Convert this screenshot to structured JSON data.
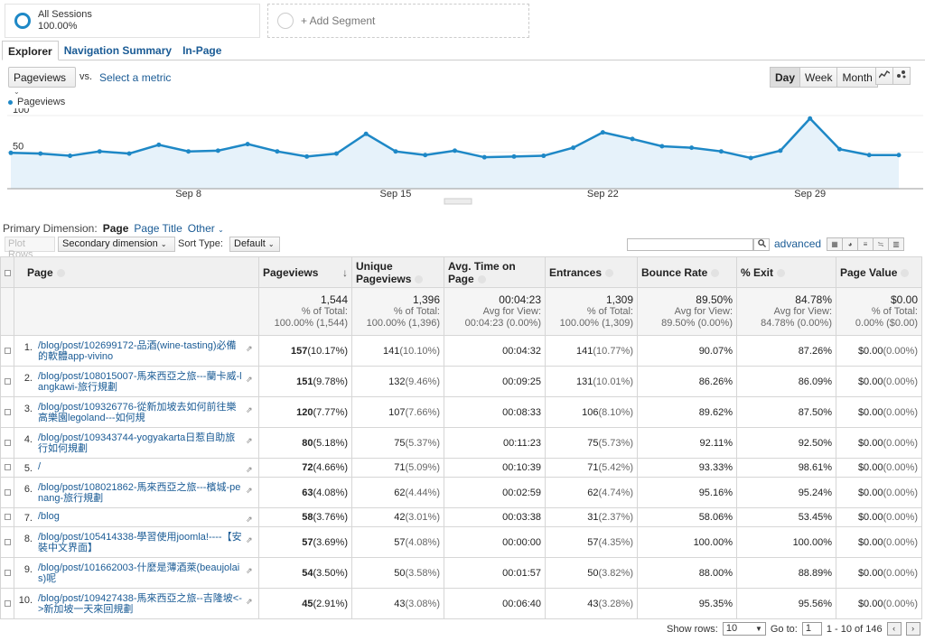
{
  "segments": {
    "all_sessions": {
      "name": "All Sessions",
      "pct": "100.00%"
    },
    "add_label": "+ Add Segment"
  },
  "tabs": [
    "Explorer",
    "Navigation Summary",
    "In-Page"
  ],
  "metric": {
    "selected": "Pageviews",
    "vs": "vs.",
    "select_metric": "Select a metric"
  },
  "period_buttons": [
    "Day",
    "Week",
    "Month"
  ],
  "chart_icons": [
    "line-chart-icon",
    "motion-chart-icon"
  ],
  "chart_data": {
    "type": "area",
    "series": [
      {
        "name": "Pageviews",
        "values": [
          49,
          48,
          45,
          51,
          48,
          60,
          51,
          52,
          61,
          51,
          44,
          48,
          75,
          51,
          46,
          52,
          43,
          44,
          45,
          56,
          77,
          68,
          58,
          56,
          51,
          42,
          52,
          96,
          54,
          46,
          46
        ]
      }
    ],
    "x_ticks": [
      {
        "index": 6,
        "label": "Sep 8"
      },
      {
        "index": 13,
        "label": "Sep 15"
      },
      {
        "index": 20,
        "label": "Sep 22"
      },
      {
        "index": 27,
        "label": "Sep 29"
      }
    ],
    "y_ticks": [
      {
        "value": 50,
        "label": "50"
      },
      {
        "value": 100,
        "label": "100"
      }
    ],
    "ylim": [
      0,
      100
    ],
    "color": "#1e88c6",
    "fill": "#e6f2fa"
  },
  "primary_dimension": {
    "label": "Primary Dimension:",
    "options": [
      "Page",
      "Page Title",
      "Other"
    ],
    "selected": "Page"
  },
  "toolbar": {
    "plot_rows": "Plot Rows",
    "secondary_dimension": "Secondary dimension",
    "sort_type_label": "Sort Type:",
    "sort_type": "Default",
    "advanced": "advanced"
  },
  "table": {
    "headers": [
      "Page",
      "Pageviews",
      "Unique Pageviews",
      "Avg. Time on Page",
      "Entrances",
      "Bounce Rate",
      "% Exit",
      "Page Value"
    ],
    "totals": [
      {
        "big": "1,544",
        "l1": "% of Total:",
        "l2": "100.00% (1,544)"
      },
      {
        "big": "1,396",
        "l1": "% of Total:",
        "l2": "100.00% (1,396)"
      },
      {
        "big": "00:04:23",
        "l1": "Avg for View:",
        "l2": "00:04:23 (0.00%)"
      },
      {
        "big": "1,309",
        "l1": "% of Total:",
        "l2": "100.00% (1,309)"
      },
      {
        "big": "89.50%",
        "l1": "Avg for View:",
        "l2": "89.50% (0.00%)"
      },
      {
        "big": "84.78%",
        "l1": "Avg for View:",
        "l2": "84.78% (0.00%)"
      },
      {
        "big": "$0.00",
        "l1": "% of Total:",
        "l2": "0.00% ($0.00)"
      }
    ],
    "rows": [
      {
        "idx": "1.",
        "page": "/blog/post/102699172-品酒(wine-tasting)必備的軟體app-vivino",
        "pv": "157",
        "pv_pct": "(10.17%)",
        "upv": "141",
        "upv_pct": "(10.10%)",
        "avg": "00:04:32",
        "ent": "141",
        "ent_pct": "(10.77%)",
        "bounce": "90.07%",
        "exit": "87.26%",
        "value": "$0.00",
        "value_pct": "(0.00%)"
      },
      {
        "idx": "2.",
        "page": "/blog/post/108015007-馬來西亞之旅---蘭卡威-langkawi-旅行規劃",
        "pv": "151",
        "pv_pct": "(9.78%)",
        "upv": "132",
        "upv_pct": "(9.46%)",
        "avg": "00:09:25",
        "ent": "131",
        "ent_pct": "(10.01%)",
        "bounce": "86.26%",
        "exit": "86.09%",
        "value": "$0.00",
        "value_pct": "(0.00%)"
      },
      {
        "idx": "3.",
        "page": "/blog/post/109326776-從新加坡去如何前往樂高樂園legoland---如何規",
        "pv": "120",
        "pv_pct": "(7.77%)",
        "upv": "107",
        "upv_pct": "(7.66%)",
        "avg": "00:08:33",
        "ent": "106",
        "ent_pct": "(8.10%)",
        "bounce": "89.62%",
        "exit": "87.50%",
        "value": "$0.00",
        "value_pct": "(0.00%)"
      },
      {
        "idx": "4.",
        "page": "/blog/post/109343744-yogyakarta日惹自助旅行如何規劃",
        "pv": "80",
        "pv_pct": "(5.18%)",
        "upv": "75",
        "upv_pct": "(5.37%)",
        "avg": "00:11:23",
        "ent": "75",
        "ent_pct": "(5.73%)",
        "bounce": "92.11%",
        "exit": "92.50%",
        "value": "$0.00",
        "value_pct": "(0.00%)"
      },
      {
        "idx": "5.",
        "page": "/",
        "pv": "72",
        "pv_pct": "(4.66%)",
        "upv": "71",
        "upv_pct": "(5.09%)",
        "avg": "00:10:39",
        "ent": "71",
        "ent_pct": "(5.42%)",
        "bounce": "93.33%",
        "exit": "98.61%",
        "value": "$0.00",
        "value_pct": "(0.00%)"
      },
      {
        "idx": "6.",
        "page": "/blog/post/108021862-馬來西亞之旅---檳城-penang-旅行規劃",
        "pv": "63",
        "pv_pct": "(4.08%)",
        "upv": "62",
        "upv_pct": "(4.44%)",
        "avg": "00:02:59",
        "ent": "62",
        "ent_pct": "(4.74%)",
        "bounce": "95.16%",
        "exit": "95.24%",
        "value": "$0.00",
        "value_pct": "(0.00%)"
      },
      {
        "idx": "7.",
        "page": "/blog",
        "pv": "58",
        "pv_pct": "(3.76%)",
        "upv": "42",
        "upv_pct": "(3.01%)",
        "avg": "00:03:38",
        "ent": "31",
        "ent_pct": "(2.37%)",
        "bounce": "58.06%",
        "exit": "53.45%",
        "value": "$0.00",
        "value_pct": "(0.00%)"
      },
      {
        "idx": "8.",
        "page": "/blog/post/105414338-學習使用joomla!----【安裝中文界面】",
        "pv": "57",
        "pv_pct": "(3.69%)",
        "upv": "57",
        "upv_pct": "(4.08%)",
        "avg": "00:00:00",
        "ent": "57",
        "ent_pct": "(4.35%)",
        "bounce": "100.00%",
        "exit": "100.00%",
        "value": "$0.00",
        "value_pct": "(0.00%)"
      },
      {
        "idx": "9.",
        "page": "/blog/post/101662003-什麼是薄酒萊(beaujolais)呢",
        "pv": "54",
        "pv_pct": "(3.50%)",
        "upv": "50",
        "upv_pct": "(3.58%)",
        "avg": "00:01:57",
        "ent": "50",
        "ent_pct": "(3.82%)",
        "bounce": "88.00%",
        "exit": "88.89%",
        "value": "$0.00",
        "value_pct": "(0.00%)"
      },
      {
        "idx": "10.",
        "page": "/blog/post/109427438-馬來西亞之旅--吉隆坡<->新加坡一天來回規劃",
        "pv": "45",
        "pv_pct": "(2.91%)",
        "upv": "43",
        "upv_pct": "(3.08%)",
        "avg": "00:06:40",
        "ent": "43",
        "ent_pct": "(3.28%)",
        "bounce": "95.35%",
        "exit": "95.56%",
        "value": "$0.00",
        "value_pct": "(0.00%)"
      }
    ]
  },
  "footer": {
    "show_rows_label": "Show rows:",
    "show_rows": "10",
    "goto_label": "Go to:",
    "goto": "1",
    "range": "1 - 10 of 146"
  }
}
